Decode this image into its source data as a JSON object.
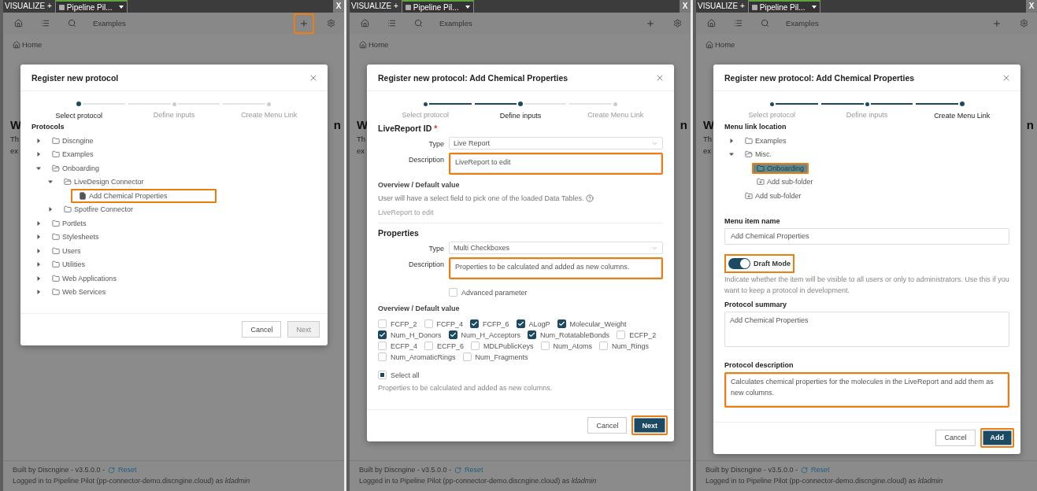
{
  "panels": [
    {
      "top_bar": {
        "app": "VISUALIZE +",
        "tab": "Pipeline Pil...",
        "close": "X"
      },
      "toolbar": {
        "title": "Examples",
        "add_highlighted": true
      },
      "breadcrumb": "Home",
      "background": {
        "heading_start": "W",
        "heading_end": "n",
        "lines": [
          "Th",
          "ex"
        ]
      },
      "dialog": {
        "title": "Register new protocol",
        "steps": [
          {
            "label": "Select protocol",
            "selected": true,
            "completed": false
          },
          {
            "label": "Define inputs",
            "selected": false,
            "completed": false
          },
          {
            "label": "Create Menu Link",
            "selected": false,
            "completed": false
          }
        ],
        "blocks": [
          {
            "kind": "heading",
            "text": "Protocols"
          },
          {
            "kind": "tree",
            "items": [
              {
                "label": "Discngine",
                "kind": "folder",
                "expanded": false
              },
              {
                "label": "Examples",
                "kind": "folder",
                "expanded": false
              },
              {
                "label": "Onboarding",
                "kind": "folder",
                "expanded": true,
                "children": [
                  {
                    "label": "LiveDesign Connector",
                    "kind": "folder",
                    "expanded": true,
                    "children": [
                      {
                        "label": "Add Chemical Properties",
                        "kind": "file",
                        "highlighted": true
                      }
                    ]
                  },
                  {
                    "label": "Spotfire Connector",
                    "kind": "folder",
                    "expanded": false
                  }
                ]
              },
              {
                "label": "Portlets",
                "kind": "folder",
                "expanded": false
              },
              {
                "label": "Stylesheets",
                "kind": "folder",
                "expanded": false
              },
              {
                "label": "Users",
                "kind": "folder",
                "expanded": false
              },
              {
                "label": "Utilities",
                "kind": "folder",
                "expanded": false
              },
              {
                "label": "Web Applications",
                "kind": "folder",
                "expanded": false
              },
              {
                "label": "Web Services",
                "kind": "folder",
                "expanded": false
              }
            ]
          }
        ],
        "buttons": [
          {
            "label": "Cancel",
            "kind": "secondary",
            "disabled": false,
            "highlighted": false
          },
          {
            "label": "Next",
            "kind": "primary",
            "disabled": true,
            "highlighted": false
          }
        ]
      },
      "footer": {
        "built_by": "Built by Discngine - v3.5.0.0 -",
        "reset": "Reset",
        "login": "Logged in to Pipeline Pilot (pp-connector-demo.discngine.cloud) as *ldadmin*"
      }
    },
    {
      "top_bar": {
        "app": "VISUALIZE +",
        "tab": "Pipeline Pil...",
        "close": "X"
      },
      "toolbar": {
        "title": "Examples",
        "add_highlighted": false
      },
      "breadcrumb": "Home",
      "background": {
        "heading_start": "W",
        "heading_end": "n",
        "lines": [
          "Th",
          "ex"
        ]
      },
      "dialog": {
        "title": "Register new protocol: Add Chemical Properties",
        "steps": [
          {
            "label": "Select protocol",
            "selected": false,
            "completed": true
          },
          {
            "label": "Define inputs",
            "selected": true,
            "completed": false
          },
          {
            "label": "Create Menu Link",
            "selected": false,
            "completed": false
          }
        ],
        "blocks": [
          {
            "kind": "section",
            "text": "LiveReport ID",
            "mark": "*",
            "divided": false
          },
          {
            "kind": "select",
            "label": "Type",
            "value": "Live Report"
          },
          {
            "kind": "textarea_row",
            "label": "Description",
            "value": "LiveReport to edit",
            "highlighted": true
          },
          {
            "kind": "subheading",
            "text": "Overview / Default value"
          },
          {
            "kind": "help",
            "text": "User will have a select field to pick one of the loaded Data Tables."
          },
          {
            "kind": "muted",
            "text": "LiveReport to edit"
          },
          {
            "kind": "section",
            "text": "Properties",
            "divided": true
          },
          {
            "kind": "select",
            "label": "Type",
            "value": "Multi Checkboxes"
          },
          {
            "kind": "textarea_row",
            "label": "Description",
            "value": "Properties to be calculated and added as new columns.",
            "highlighted": true
          },
          {
            "kind": "checkbox",
            "label": "Advanced parameter",
            "checked": false
          },
          {
            "kind": "subheading",
            "text": "Overview / Default value"
          },
          {
            "kind": "checkbox_group",
            "options": [
              {
                "label": "FCFP_2",
                "checked": false
              },
              {
                "label": "FCFP_4",
                "checked": false
              },
              {
                "label": "FCFP_6",
                "checked": true
              },
              {
                "label": "ALogP",
                "checked": true
              },
              {
                "label": "Molecular_Weight",
                "checked": true
              },
              {
                "label": "Num_H_Donors",
                "checked": true
              },
              {
                "label": "Num_H_Acceptors",
                "checked": true
              },
              {
                "label": "Num_RotatableBonds",
                "checked": true
              },
              {
                "label": "ECFP_2",
                "checked": false
              },
              {
                "label": "ECFP_4",
                "checked": false
              },
              {
                "label": "ECFP_6",
                "checked": false
              },
              {
                "label": "MDLPublicKeys",
                "checked": false
              },
              {
                "label": "Num_Atoms",
                "checked": false
              },
              {
                "label": "Num_Rings",
                "checked": false
              },
              {
                "label": "Num_AromaticRings",
                "checked": false
              },
              {
                "label": "Num_Fragments",
                "checked": false
              }
            ],
            "select_all": {
              "label": "Select all",
              "indeterminate": true
            },
            "hint": "Properties to be calculated and added as new columns."
          }
        ],
        "buttons": [
          {
            "label": "Cancel",
            "kind": "secondary",
            "disabled": false,
            "highlighted": false
          },
          {
            "label": "Next",
            "kind": "primary",
            "disabled": false,
            "highlighted": true
          }
        ]
      },
      "footer": {
        "built_by": "Built by Discngine - v3.5.0.0 -",
        "reset": "Reset",
        "login": "Logged in to Pipeline Pilot (pp-connector-demo.discngine.cloud) as *ldadmin*"
      }
    },
    {
      "top_bar": {
        "app": "VISUALIZE +",
        "tab": "Pipeline Pil...",
        "close": "X"
      },
      "toolbar": {
        "title": "Examples",
        "add_highlighted": false
      },
      "breadcrumb": "Home",
      "background": {
        "heading_start": "W",
        "heading_end": "n",
        "lines": [
          "Th",
          "ex"
        ]
      },
      "dialog": {
        "title": "Register new protocol: Add Chemical Properties",
        "steps": [
          {
            "label": "Select protocol",
            "selected": false,
            "completed": true
          },
          {
            "label": "Define inputs",
            "selected": false,
            "completed": true
          },
          {
            "label": "Create Menu Link",
            "selected": true,
            "completed": false
          }
        ],
        "blocks": [
          {
            "kind": "heading",
            "text": "Menu link location"
          },
          {
            "kind": "tree",
            "items": [
              {
                "label": "Examples",
                "kind": "folder",
                "expanded": false
              },
              {
                "label": "Misc.",
                "kind": "folder",
                "expanded": true,
                "children": [
                  {
                    "label": "Onboarding",
                    "kind": "folder",
                    "selected": true,
                    "highlighted": true
                  },
                  {
                    "label": "Add sub-folder",
                    "kind": "add"
                  }
                ]
              },
              {
                "label": "Add sub-folder",
                "kind": "add"
              }
            ]
          },
          {
            "kind": "heading",
            "text": "Menu item name",
            "spaced": true
          },
          {
            "kind": "input",
            "value": "Add Chemical Properties"
          },
          {
            "kind": "toggle",
            "label": "Draft Mode",
            "on": true,
            "highlighted": true
          },
          {
            "kind": "help",
            "text": "Indicate whether the item will be visible to all users or only to administrators. Use this if you want to keep a protocol in development."
          },
          {
            "kind": "heading",
            "text": "Protocol summary"
          },
          {
            "kind": "textarea",
            "value": "Add Chemical Properties",
            "highlighted": false
          },
          {
            "kind": "heading",
            "text": "Protocol description",
            "spaced": true
          },
          {
            "kind": "textarea",
            "value": "Calculates chemical properties for the molecules in the LiveReport and add them as new columns.",
            "highlighted": true
          }
        ],
        "buttons": [
          {
            "label": "Cancel",
            "kind": "secondary",
            "disabled": false,
            "highlighted": false
          },
          {
            "label": "Add",
            "kind": "primary",
            "disabled": false,
            "highlighted": true
          }
        ]
      },
      "footer": {
        "built_by": "Built by Discngine - v3.5.0.0 -",
        "reset": "Reset",
        "login": "Logged in to Pipeline Pilot (pp-connector-demo.discngine.cloud) as *ldadmin*"
      }
    }
  ]
}
